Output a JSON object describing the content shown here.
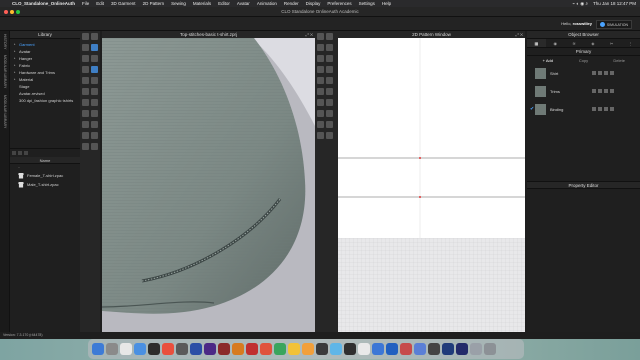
{
  "menubar": {
    "app_name": "CLO_Standalone_OnlineAuth",
    "items": [
      "File",
      "Edit",
      "3D Garment",
      "2D Pattern",
      "Sewing",
      "Materials",
      "Editor",
      "Avatar",
      "Animation",
      "Render",
      "Display",
      "Preferences",
      "Settings",
      "Help"
    ],
    "clock": "Thu Jan 18 12:47 PM"
  },
  "window": {
    "title": "CLO Standalone OnlineAuth Academic"
  },
  "header": {
    "greeting": "Hello,",
    "username": "rosswilley",
    "simulation_label": "SIMULATION"
  },
  "sidetabs": [
    "HISTORY",
    "MODULAR LIBRARY",
    "MODULAR LIBRARY"
  ],
  "library": {
    "title": "Library",
    "items": [
      {
        "label": "Garment",
        "selected": true
      },
      {
        "label": "Avatar"
      },
      {
        "label": "Hanger"
      },
      {
        "label": "Fabric"
      },
      {
        "label": "Hardware and Trims"
      },
      {
        "label": "Material"
      },
      {
        "label": "Stage"
      },
      {
        "label": "Avatar-revised"
      },
      {
        "label": "300 dpi_fashion graphic tshirts"
      }
    ],
    "name_header": "Name",
    "files": [
      {
        "label": ".."
      },
      {
        "label": "Female_T-shirt.zpac"
      },
      {
        "label": "Male_T-shirt.zpac"
      }
    ]
  },
  "view3d": {
    "title": "Top-stitches-basic t-shirt.zprj"
  },
  "view2d": {
    "title": "2D Pattern Window"
  },
  "object_browser": {
    "title": "Object Browser",
    "primary_label": "Primary",
    "add_label": "+ Add",
    "tabs": [
      "Add",
      "Copy",
      "Delete"
    ],
    "fabrics": [
      {
        "name": "Shirt",
        "checked": false
      },
      {
        "name": "Trims",
        "checked": false
      },
      {
        "name": "Binding",
        "checked": true
      }
    ],
    "property_editor_title": "Property Editor"
  },
  "status": {
    "version": "Version: 7.3.170 (r44478)"
  },
  "colors": {
    "accent": "#4aa3ff",
    "fabric": "#7d8a86",
    "viewport_bg": "#dcdce2"
  }
}
